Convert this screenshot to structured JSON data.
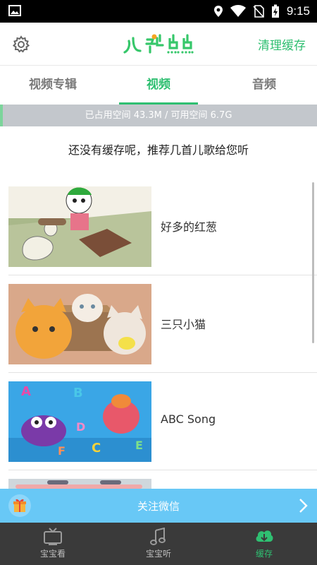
{
  "status_bar": {
    "time": "9:15",
    "icons": [
      "image-icon",
      "location-icon",
      "wifi-icon",
      "no-sim-icon",
      "battery-charging-icon"
    ]
  },
  "header": {
    "logo_text": "儿歌点点",
    "clear_cache_label": "清理缓存",
    "settings_icon": "gear-icon"
  },
  "tabs": [
    {
      "label": "视频专辑",
      "active": false
    },
    {
      "label": "视频",
      "active": true
    },
    {
      "label": "音频",
      "active": false
    }
  ],
  "storage": {
    "text": "已占用空间 43.3M / 可用空间 6.7G",
    "used": "43.3M",
    "available": "6.7G"
  },
  "notice": "还没有缓存呢，推荐几首儿歌给您听",
  "songs": [
    {
      "title": "好多的红葱"
    },
    {
      "title": "三只小猫"
    },
    {
      "title": "ABC Song"
    },
    {
      "title": ""
    }
  ],
  "follow_banner": {
    "label": "关注微信",
    "icon": "gift-icon"
  },
  "bottom_nav": [
    {
      "label": "宝宝看",
      "icon": "tv-icon",
      "active": false
    },
    {
      "label": "宝宝听",
      "icon": "music-note-icon",
      "active": false
    },
    {
      "label": "缓存",
      "icon": "cloud-download-icon",
      "active": true
    }
  ],
  "colors": {
    "accent": "#2fbf71",
    "banner": "#68c8f6",
    "nav_bg": "#3a3a3a",
    "storage_bg": "#c3c7cc"
  }
}
